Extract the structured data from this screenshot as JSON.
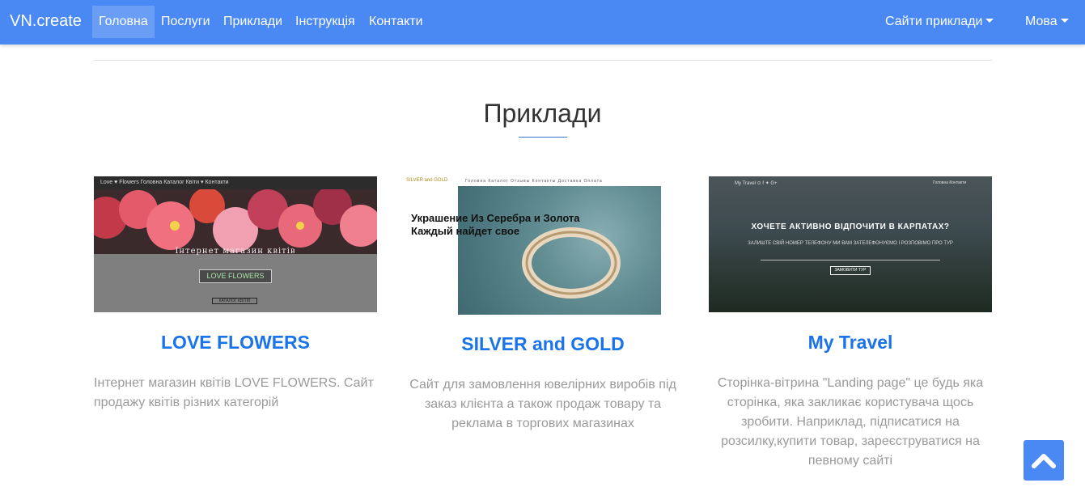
{
  "navbar": {
    "brand": "VN.create",
    "items": [
      {
        "label": "Головна",
        "active": true
      },
      {
        "label": "Послуги"
      },
      {
        "label": "Приклади"
      },
      {
        "label": "Інструкція"
      },
      {
        "label": "Контакти"
      }
    ],
    "dropdowns": [
      {
        "label": "Сайти приклади"
      },
      {
        "label": "Мова"
      }
    ],
    "color": "#4a89f3"
  },
  "section": {
    "title": "Приклади"
  },
  "cards": [
    {
      "title": "LOVE FLOWERS",
      "description": "Інтернет магазин квітів LOVE FLOWERS. Сайт продажу квітів різних категорій",
      "thumb": {
        "nav": "Love ♥ Flowers   Головна  Каталог  Квіти ▾  Контакти",
        "heading": "Інтернет магазин квітів",
        "button": "LOVE FLOWERS",
        "button2": "КАТАЛОГ КВІТІВ"
      }
    },
    {
      "title": "SILVER and GOLD",
      "description": "Сайт для замовлення ювелірних виробів під заказ клієнта а також продаж товару та реклама в торгових магазинах",
      "thumb": {
        "logo": "SILVER and GOLD",
        "nav": "Головна   Каталог   Отзывы   Контакты   Доставка   Оплата",
        "heading": "Украшение Из Серебра и Золота Каждый найдет свое"
      }
    },
    {
      "title": "My Travel",
      "description": "Сторінка-вітрина \"Landing page\" це будь яка сторінка, яка закликає користувача щось зробити. Наприклад, підписатися на розсилку,купити товар, зареєструватися на певному сайті",
      "thumb": {
        "nav": "My Travel   ⊙ f ✦ G+",
        "nav_right": "Головна   Контакти",
        "heading": "ХОЧЕТЕ АКТИВНО ВІДПОЧИТИ В КАРПАТАХ?",
        "sub": "ЗАЛИШТЕ СВІЙ НОМЕР ТЕЛЕФОНУ МИ ВАМ ЗАТЕЛЕФОНУЄМО І РОЗПОВІМО ПРО ТУР",
        "button": "ЗАМОВИТИ ТУР"
      }
    }
  ],
  "scroll_top": {
    "icon": "chevron-up-icon",
    "color": "#4a89f3"
  }
}
